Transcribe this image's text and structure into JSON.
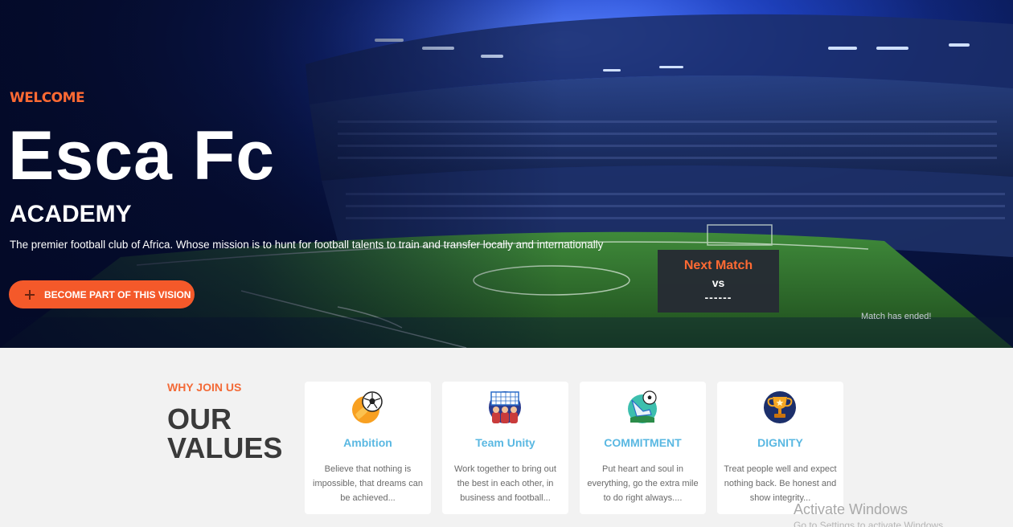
{
  "hero": {
    "welcome": "WELCOME",
    "title": "Esca Fc",
    "subtitle": "ACADEMY",
    "description": "The premier football club of Africa. Whose mission is to hunt for football talents to train and transfer locally and internationally",
    "cta_label": "BECOME PART OF THIS VISION"
  },
  "next_match": {
    "title": "Next Match",
    "vs": "vs",
    "opponent": "------",
    "status": "Match has ended!"
  },
  "values": {
    "eyebrow": "WHY JOIN US",
    "title": "OUR VALUES",
    "cards": [
      {
        "icon": "ball-fire-icon",
        "title": "Ambition",
        "desc": "Believe that nothing is impossible, that dreams can be achieved..."
      },
      {
        "icon": "team-players-icon",
        "title": "Team Unity",
        "desc": "Work together to bring out the best in each other, in business and football..."
      },
      {
        "icon": "boot-ball-icon",
        "title": "COMMITMENT",
        "desc": "Put heart and soul in everything, go the extra mile to do right always...."
      },
      {
        "icon": "trophy-icon",
        "title": "DIGNITY",
        "desc": "Treat people well and expect nothing back. Be honest and show integrity..."
      }
    ]
  },
  "watermark": {
    "line1": "Activate Windows",
    "line2": "Go to Settings to activate Windows."
  },
  "colors": {
    "accent": "#f4592a",
    "card_title": "#5ab8e2",
    "hero_bg": "#07123d"
  }
}
